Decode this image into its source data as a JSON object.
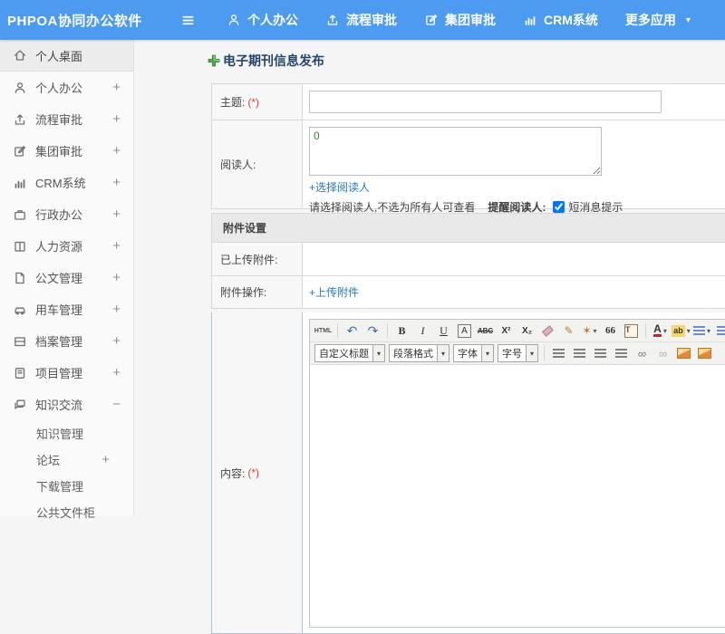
{
  "header": {
    "logo": "PHPOA协同办公软件",
    "nav": [
      {
        "name": "nav-personal-office",
        "icon": "person",
        "label": "个人办公"
      },
      {
        "name": "nav-workflow-approval",
        "icon": "workflow",
        "label": "流程审批"
      },
      {
        "name": "nav-group-approval",
        "icon": "edit",
        "label": "集团审批"
      },
      {
        "name": "nav-crm-system",
        "icon": "chart",
        "label": "CRM系统"
      },
      {
        "name": "nav-more-apps",
        "icon": "",
        "label": "更多应用",
        "caret": "▾"
      }
    ]
  },
  "sidebar": {
    "items": [
      {
        "name": "sidebar-item-personal-desktop",
        "icon": "home",
        "label": "个人桌面",
        "expander": "",
        "active": true,
        "sub": false
      },
      {
        "name": "sidebar-item-personal-office",
        "icon": "person",
        "label": "个人办公",
        "expander": "+",
        "active": false,
        "sub": false
      },
      {
        "name": "sidebar-item-workflow-approval",
        "icon": "workflow",
        "label": "流程审批",
        "expander": "+",
        "active": false,
        "sub": false
      },
      {
        "name": "sidebar-item-group-approval",
        "icon": "edit",
        "label": "集团审批",
        "expander": "+",
        "active": false,
        "sub": false
      },
      {
        "name": "sidebar-item-crm-system",
        "icon": "chart",
        "label": "CRM系统",
        "expander": "+",
        "active": false,
        "sub": false
      },
      {
        "name": "sidebar-item-admin-office",
        "icon": "briefcase",
        "label": "行政办公",
        "expander": "+",
        "active": false,
        "sub": false
      },
      {
        "name": "sidebar-item-hr",
        "icon": "book",
        "label": "人力资源",
        "expander": "+",
        "active": false,
        "sub": false
      },
      {
        "name": "sidebar-item-document-mgmt",
        "icon": "doc",
        "label": "公文管理",
        "expander": "+",
        "active": false,
        "sub": false
      },
      {
        "name": "sidebar-item-vehicle-mgmt",
        "icon": "car",
        "label": "用车管理",
        "expander": "+",
        "active": false,
        "sub": false
      },
      {
        "name": "sidebar-item-archive-mgmt",
        "icon": "archive",
        "label": "档案管理",
        "expander": "+",
        "active": false,
        "sub": false
      },
      {
        "name": "sidebar-item-project-mgmt",
        "icon": "notebook",
        "label": "项目管理",
        "expander": "+",
        "active": false,
        "sub": false
      },
      {
        "name": "sidebar-item-knowledge-exchange",
        "icon": "chat",
        "label": "知识交流",
        "expander": "−",
        "active": false,
        "sub": false
      },
      {
        "name": "sidebar-item-knowledge-mgmt",
        "icon": "",
        "label": "知识管理",
        "expander": "",
        "active": false,
        "sub": true
      },
      {
        "name": "sidebar-item-forum",
        "icon": "",
        "label": "论坛",
        "expander": "+",
        "active": false,
        "sub": true
      },
      {
        "name": "sidebar-item-download-mgmt",
        "icon": "",
        "label": "下载管理",
        "expander": "",
        "active": false,
        "sub": true
      },
      {
        "name": "sidebar-item-public-file-cabinet",
        "icon": "",
        "label": "公共文件柜",
        "expander": "",
        "active": false,
        "sub": true
      }
    ]
  },
  "main": {
    "page_title": "电子期刊信息发布",
    "form": {
      "subject": {
        "label": "主题:",
        "required": "(*)",
        "value": "",
        "placeholder": ""
      },
      "readers": {
        "label": "阅读人:",
        "value": "0",
        "select_link": "+选择阅读人",
        "hint": "请选择阅读人,不选为所有人可查看",
        "remind_label": "提醒阅读人:",
        "sms_label": "短消息提示",
        "sms_checked": true
      },
      "attachments": {
        "section_title": "附件设置",
        "uploaded_label": "已上传附件:",
        "uploaded_value": "",
        "ops_label": "附件操作:",
        "upload_link": "+上传附件"
      },
      "content": {
        "label": "内容:",
        "required": "(*)"
      }
    },
    "editor": {
      "row1": [
        {
          "name": "source-code-button",
          "glyph": "HTML",
          "cls": "t-html"
        },
        {
          "sep": true
        },
        {
          "name": "undo-icon",
          "glyph": "↶",
          "cls": "t-blue"
        },
        {
          "name": "redo-icon",
          "glyph": "↷",
          "cls": "t-blue"
        },
        {
          "sep": true
        },
        {
          "name": "bold-icon",
          "glyph": "B",
          "cls": "t-bold"
        },
        {
          "name": "italic-icon",
          "glyph": "I",
          "cls": "t-italic"
        },
        {
          "name": "underline-icon",
          "glyph": "U",
          "cls": "t-underline"
        },
        {
          "name": "font-style-icon",
          "glyph": "A",
          "cls": "t-boxed"
        },
        {
          "name": "strikethrough-icon",
          "glyph": "ABC",
          "cls": "t-strike"
        },
        {
          "name": "superscript-icon",
          "glyph": "X²",
          "cls": "t-small"
        },
        {
          "name": "subscript-icon",
          "glyph": "X₂",
          "cls": "t-small"
        },
        {
          "name": "remove-format-icon",
          "shape": "shape-eraser"
        },
        {
          "name": "format-brush-icon",
          "glyph": "✎",
          "cls": "t-orange"
        },
        {
          "name": "quick-format-icon",
          "glyph": "✶",
          "cls": "t-orange",
          "caret": "▾"
        },
        {
          "name": "blockquote-icon",
          "glyph": "66",
          "cls": "t-quote"
        },
        {
          "name": "paste-text-icon",
          "glyph": "T",
          "cls": "t-paste"
        },
        {
          "sep": true
        },
        {
          "name": "font-color-icon",
          "glyph": "A",
          "cls": "t-fontcolor",
          "caret": "▾"
        },
        {
          "name": "highlight-color-icon",
          "glyph": "ab",
          "cls": "t-highlight",
          "caret": "▾"
        },
        {
          "name": "ordered-list-icon",
          "shape": "shape-lines blue",
          "caret": "▾"
        },
        {
          "name": "unordered-list-icon",
          "shape": "shape-lines blue"
        }
      ],
      "row2": [
        {
          "name": "heading-select",
          "select": "自定义标题"
        },
        {
          "name": "paragraph-select",
          "select": "段落格式"
        },
        {
          "name": "font-family-select",
          "select": "字体"
        },
        {
          "name": "font-size-select",
          "select": "字号"
        },
        {
          "sep": true
        },
        {
          "name": "align-left-icon",
          "shape": "shape-lines"
        },
        {
          "name": "align-center-icon",
          "shape": "shape-lines"
        },
        {
          "name": "align-right-icon",
          "shape": "shape-lines"
        },
        {
          "name": "align-justify-icon",
          "shape": "shape-lines"
        },
        {
          "name": "link-icon",
          "glyph": "∞",
          "cls": "t-gray"
        },
        {
          "name": "unlink-icon",
          "glyph": "∞",
          "cls": "t-gray dim"
        },
        {
          "name": "image-icon",
          "shape": "shape-image"
        },
        {
          "name": "media-icon",
          "shape": "shape-image"
        }
      ]
    }
  },
  "colors": {
    "header_bg": "#4d9bf0",
    "link_blue": "#2779c8",
    "required_red": "#e03c3c",
    "title_navy": "#24456b",
    "plus_green": "#4bae4c",
    "reader_value_green": "#2f8f2f"
  }
}
